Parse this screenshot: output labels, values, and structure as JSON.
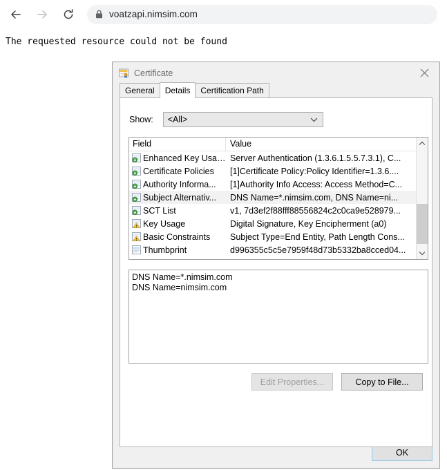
{
  "browser": {
    "back_icon": "back-arrow-icon",
    "forward_icon": "forward-arrow-icon",
    "reload_icon": "reload-icon",
    "lock_icon": "lock-icon",
    "url": "voatzapi.nimsim.com"
  },
  "page": {
    "body_text": "The requested resource could not be found"
  },
  "dialog": {
    "title": "Certificate",
    "title_icon": "certificate-icon",
    "close_label": "✕",
    "tabs": [
      {
        "label": "General",
        "active": false
      },
      {
        "label": "Details",
        "active": true
      },
      {
        "label": "Certification Path",
        "active": false
      }
    ],
    "show": {
      "label": "Show:",
      "value": "<All>",
      "arrow": "chevron-down-icon"
    },
    "list": {
      "columns": [
        "Field",
        "Value"
      ],
      "rows": [
        {
          "icon": "extension-icon",
          "field": "Enhanced Key Usage",
          "value": "Server Authentication (1.3.6.1.5.5.7.3.1), C...",
          "selected": false
        },
        {
          "icon": "extension-icon",
          "field": "Certificate Policies",
          "value": "[1]Certificate Policy:Policy Identifier=1.3.6....",
          "selected": false
        },
        {
          "icon": "extension-icon",
          "field": "Authority Informa...",
          "value": "[1]Authority Info Access: Access Method=C...",
          "selected": false
        },
        {
          "icon": "extension-icon",
          "field": "Subject Alternativ...",
          "value": "DNS Name=*.nimsim.com, DNS Name=ni...",
          "selected": true
        },
        {
          "icon": "extension-icon",
          "field": "SCT List",
          "value": "v1, 7d3ef2f88fff88556824c2c0ca9e528979...",
          "selected": false
        },
        {
          "icon": "critical-extension-icon",
          "field": "Key Usage",
          "value": "Digital Signature, Key Encipherment (a0)",
          "selected": false
        },
        {
          "icon": "critical-extension-icon",
          "field": "Basic Constraints",
          "value": "Subject Type=End Entity, Path Length Cons...",
          "selected": false
        },
        {
          "icon": "property-icon",
          "field": "Thumbprint",
          "value": "d996355c5c5e7959f48d73b5332ba8cced04...",
          "selected": false
        }
      ],
      "scroll_up_icon": "chevron-up-icon",
      "scroll_down_icon": "chevron-down-icon"
    },
    "detail_value": "DNS Name=*.nimsim.com\nDNS Name=nimsim.com",
    "buttons": {
      "edit_properties": "Edit Properties...",
      "copy_to_file": "Copy to File...",
      "ok": "OK"
    }
  },
  "colors": {
    "dialog_face": "#f0f0f0",
    "panel": "#ffffff",
    "border": "#a0a0a0",
    "selection": "#f2f2f2",
    "scroll_thumb": "#cdcdcd",
    "focus_ring": "#9ec8e0",
    "disabled_text": "#a0a0a0",
    "title_text": "#6d6d6d"
  }
}
